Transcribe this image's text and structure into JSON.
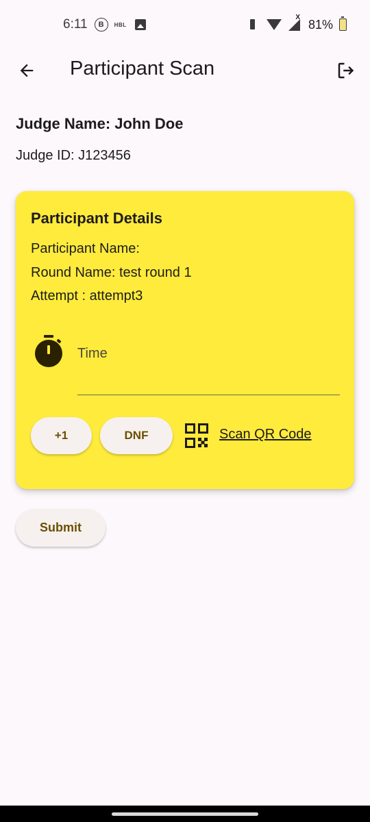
{
  "status_bar": {
    "time": "6:11",
    "b_icon_letter": "B",
    "hbl_label": "HBL",
    "network_x": "X",
    "battery_percent": "81%"
  },
  "app_bar": {
    "title": "Participant Scan",
    "back_icon": "arrow-back-icon",
    "logout_icon": "logout-icon"
  },
  "judge": {
    "name_line": "Judge Name: John Doe",
    "id_line": "Judge ID: J123456"
  },
  "card": {
    "title": "Participant Details",
    "participant_name_line": "Participant Name:",
    "round_name_line": "Round Name: test round 1",
    "attempt_line": "Attempt : attempt3",
    "time_label": "Time",
    "time_value": "",
    "plus_one_label": "+1",
    "dnf_label": "DNF",
    "scan_qr_label": "Scan QR Code",
    "background_color": "#ffeb3b"
  },
  "actions": {
    "submit_label": "Submit"
  },
  "colors": {
    "accent_text": "#6b4f00",
    "page_background": "#fdf8fb"
  }
}
